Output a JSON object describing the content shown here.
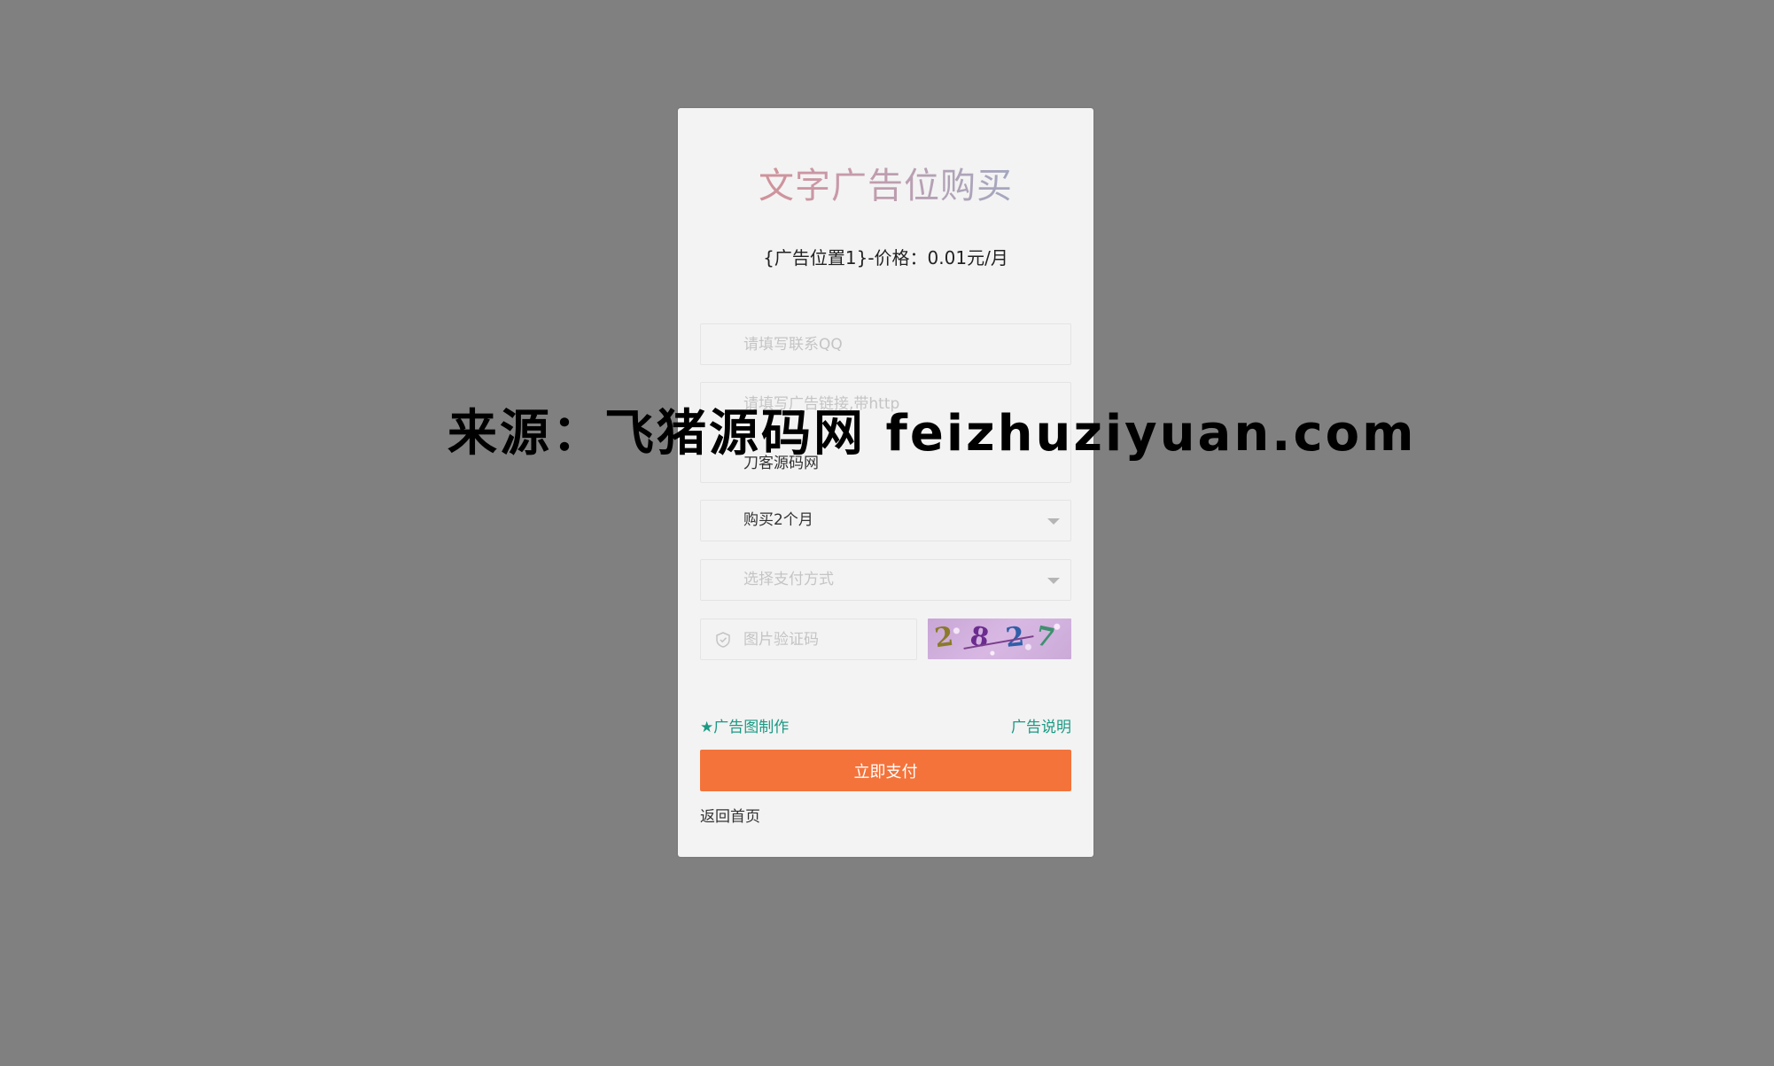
{
  "form": {
    "title": "文字广告位购买",
    "price_line": "{广告位置1}-价格：0.01元/月",
    "qq_placeholder": "请填写联系QQ",
    "link_placeholder": "请填写广告链接,带http",
    "link_value": "刀客源码网",
    "month_selected": "购买2个月",
    "pay_placeholder": "选择支付方式",
    "captcha_placeholder": "图片验证码",
    "captcha_digits": [
      "2",
      "8",
      "2",
      "7"
    ],
    "make_link": "★广告图制作",
    "desc_link": "广告说明",
    "pay_button": "立即支付",
    "home_link": "返回首页"
  },
  "colors": {
    "accent": "#f4733b",
    "link": "#1a9a83",
    "background": "#808080",
    "card": "#f3f3f3"
  },
  "icons": {
    "captcha_field": "shield-check-icon",
    "select_caret": "caret-down-icon"
  },
  "watermark": "来源：飞猪源码网 feizhuziyuan.com"
}
